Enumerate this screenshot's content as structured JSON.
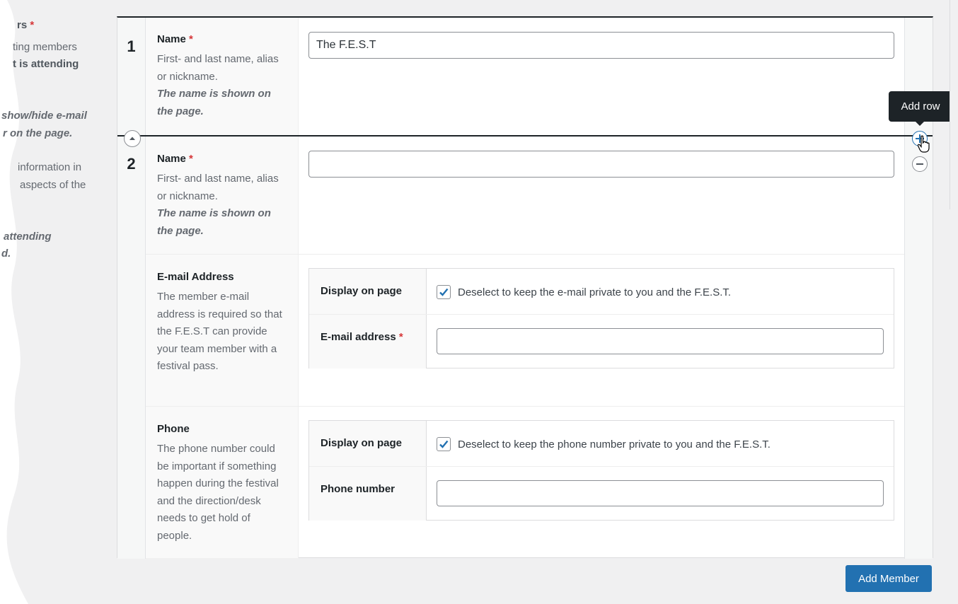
{
  "sidebar": {
    "line1": "rs",
    "line1_req": "*",
    "line2": "ting members",
    "line3": "t is attending",
    "line4": "show/hide e-mail",
    "line5": "r on the page.",
    "line6": "information in",
    "line7": "aspects of the",
    "line8": "attending",
    "line9": "d."
  },
  "rows": [
    {
      "number": "1",
      "name_label": "Name",
      "required_mark": "*",
      "name_desc": "First- and last name, alias or nickname.",
      "name_desc_em": "The name is shown on the page.",
      "name_value": "The F.E.S.T"
    },
    {
      "number": "2",
      "name_label": "Name",
      "required_mark": "*",
      "name_desc": "First- and last name, alias or nickname.",
      "name_desc_em": "The name is shown on the page.",
      "name_value": "",
      "email": {
        "label": "E-mail Address",
        "desc": "The member e-mail address is required so that the F.E.S.T can provide your team member with a festival pass.",
        "display_label": "Display on page",
        "display_checked": true,
        "display_text": "Deselect to keep the e-mail private to you and the F.E.S.T.",
        "address_label": "E-mail address",
        "address_required": "*",
        "address_value": ""
      },
      "phone": {
        "label": "Phone",
        "desc": "The phone number could be important if something happen during the festival and the direction/desk needs to get hold of people.",
        "display_label": "Display on page",
        "display_checked": true,
        "display_text": "Deselect to keep the phone number private to you and the F.E.S.T.",
        "number_label": "Phone number",
        "number_value": ""
      }
    }
  ],
  "tooltip": "Add row",
  "add_member_button": "Add Member",
  "icons": {
    "collapse": "chevron-up-icon",
    "add_row": "plus-circle-icon",
    "remove_row": "minus-circle-icon",
    "cursor": "hand-pointer-icon"
  },
  "colors": {
    "primary": "#2271b1",
    "required": "#d63638",
    "tooltip_bg": "#1d2327"
  }
}
